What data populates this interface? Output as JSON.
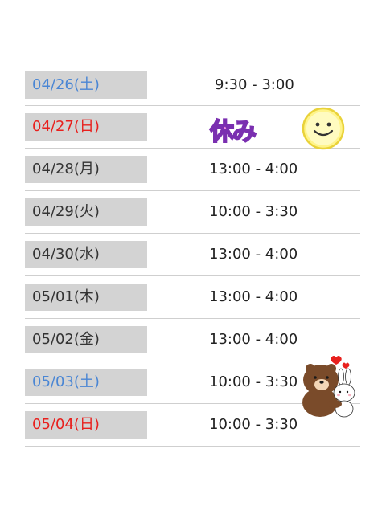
{
  "schedule": [
    {
      "date": "04/26(土)",
      "day_type": "saturday",
      "time": "9:30 - 3:00"
    },
    {
      "date": "04/27(日)",
      "day_type": "sunday",
      "time": "",
      "note": "休み",
      "decoration": "smiley-icon"
    },
    {
      "date": "04/28(月)",
      "day_type": "weekday",
      "time": "13:00 - 4:00"
    },
    {
      "date": "04/29(火)",
      "day_type": "weekday",
      "time": "10:00 - 3:30"
    },
    {
      "date": "04/30(水)",
      "day_type": "weekday",
      "time": "13:00 - 4:00"
    },
    {
      "date": "05/01(木)",
      "day_type": "weekday",
      "time": "13:00 - 4:00"
    },
    {
      "date": "05/02(金)",
      "day_type": "weekday",
      "time": "13:00 - 4:00"
    },
    {
      "date": "05/03(土)",
      "day_type": "saturday",
      "time": "10:00 - 3:30",
      "decoration": "bear-bunny-sticker"
    },
    {
      "date": "05/04(日)",
      "day_type": "sunday",
      "time": "10:00 - 3:30"
    }
  ],
  "colors": {
    "saturday": "#4a86d4",
    "sunday": "#e8201d",
    "weekday": "#333333",
    "date_background": "#d3d3d3",
    "holiday_fill": "#f08de0",
    "holiday_outline": "#7a2fb0"
  }
}
